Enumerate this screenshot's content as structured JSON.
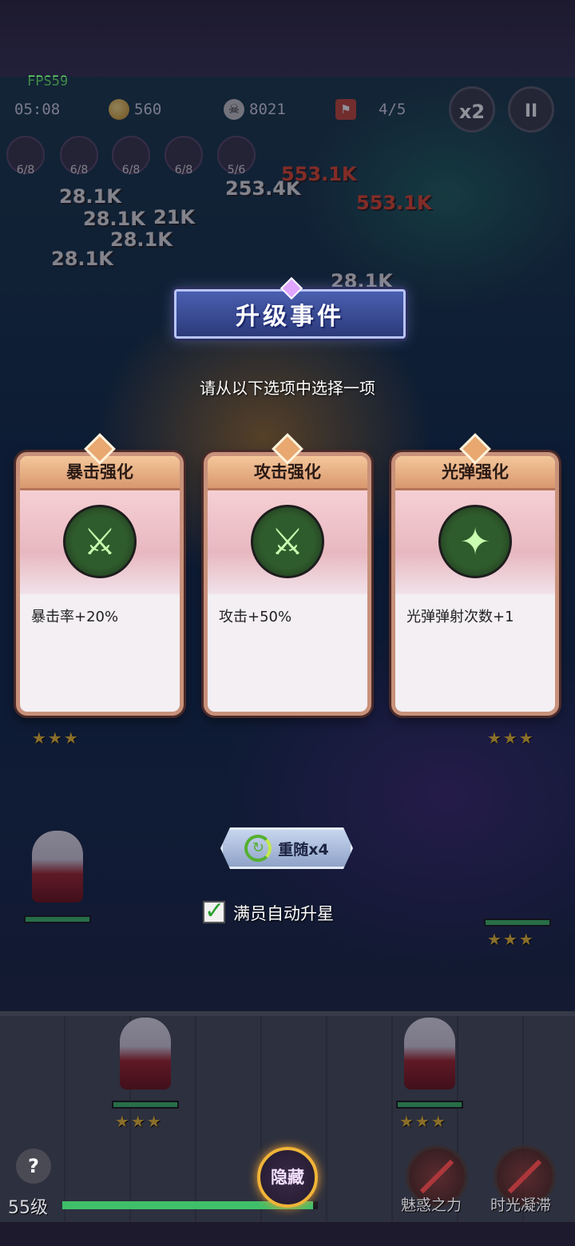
{
  "hud": {
    "fps": "FPS59",
    "timer": "05:08",
    "coins": "560",
    "kills": "8021",
    "wave": "4/5",
    "speed_label": "x2",
    "pause_label": "II"
  },
  "skill_slots": [
    {
      "icon": "sword-skill-icon",
      "count": "6/8"
    },
    {
      "icon": "blade-skill-icon",
      "count": "6/8"
    },
    {
      "icon": "vortex-skill-icon",
      "count": "6/8"
    },
    {
      "icon": "crosshair-skill-icon",
      "count": "6/8"
    },
    {
      "icon": "bird-skill-icon",
      "count": "5/6"
    }
  ],
  "damage_numbers": {
    "d1": "28.1K",
    "d2": "28.1K",
    "d3": "21K",
    "d4": "28.1K",
    "d5": "28.1K",
    "d6": "253.4K",
    "d7": "553.1K",
    "d8": "553.1K",
    "d9": "28.1K"
  },
  "modal": {
    "title": "升级事件",
    "subtitle": "请从以下选项中选择一项",
    "cards": [
      {
        "title": "暴击强化",
        "icon": "crit-sword-icon",
        "desc": "暴击率+20%"
      },
      {
        "title": "攻击强化",
        "icon": "crossed-swords-icon",
        "desc": "攻击+50%"
      },
      {
        "title": "光弹强化",
        "icon": "light-bullet-icon",
        "desc": "光弹弹射次数+1"
      }
    ],
    "reroll_label": "重随x4",
    "auto_upgrade_label": "满员自动升星",
    "auto_upgrade_checked": true
  },
  "bottom": {
    "help_label": "?",
    "level": "55级",
    "xp_progress": 0.98,
    "hide_label": "隐藏",
    "ability_1": "魅惑之力",
    "ability_2": "时光凝滞"
  },
  "colors": {
    "accent_gold": "#f0b438",
    "hp_green": "#3fbf6a",
    "banner_blue": "#4a5fb0"
  }
}
